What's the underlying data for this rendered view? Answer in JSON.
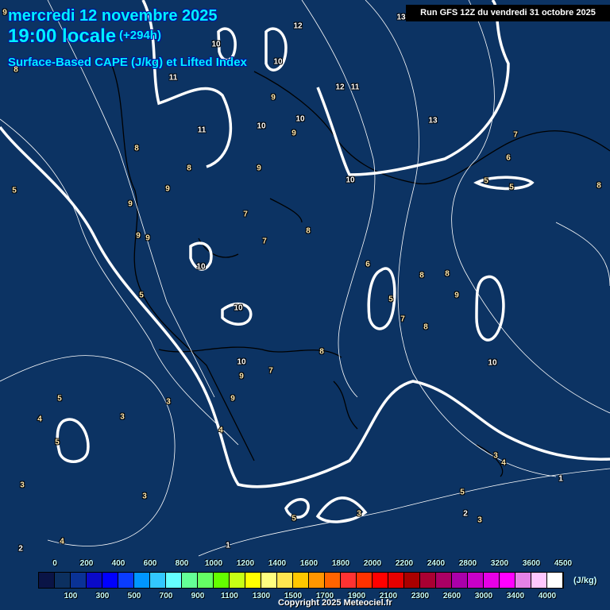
{
  "header": {
    "date": "mercredi 12 novembre 2025",
    "time": "19:00 locale",
    "lead": "(+294h)",
    "parameter": "Surface-Based CAPE (J/kg) et Lifted Index",
    "run": "Run GFS 12Z du vendredi 31 octobre 2025"
  },
  "contour_labels": [
    "9",
    "8",
    "11",
    "10",
    "10",
    "12",
    "13",
    "11",
    "12",
    "9",
    "10",
    "10",
    "9",
    "13",
    "11",
    "8",
    "8",
    "9",
    "6",
    "7",
    "5",
    "5",
    "5",
    "8",
    "9",
    "10",
    "9",
    "9",
    "7",
    "8",
    "7",
    "10",
    "6",
    "8",
    "8",
    "5",
    "9",
    "9",
    "7",
    "8",
    "5",
    "10",
    "10",
    "8",
    "10",
    "9",
    "7",
    "9",
    "3",
    "4",
    "5",
    "3",
    "5",
    "4",
    "3",
    "4",
    "3",
    "3",
    "5",
    "5",
    "3",
    "2",
    "3",
    "4",
    "1",
    "2",
    "1"
  ],
  "colorbar": {
    "unit": "(J/kg)",
    "top_labels": [
      "0",
      "200",
      "400",
      "600",
      "800",
      "1000",
      "1200",
      "1400",
      "1600",
      "1800",
      "2000",
      "2200",
      "2400",
      "2800",
      "3200",
      "3600",
      "4500"
    ],
    "bottom_labels": [
      "100",
      "300",
      "500",
      "700",
      "900",
      "1100",
      "1300",
      "1500",
      "1700",
      "1900",
      "2100",
      "2300",
      "2600",
      "3000",
      "3400",
      "4000"
    ],
    "colors": [
      "#0a1446",
      "#0c3060",
      "#0a3296",
      "#0a0ac8",
      "#0000ff",
      "#0a3cff",
      "#0096ff",
      "#32c8ff",
      "#64ffff",
      "#64ff96",
      "#64ff64",
      "#64ff00",
      "#c8ff14",
      "#ffff00",
      "#ffff80",
      "#ffe650",
      "#ffc800",
      "#ff9600",
      "#ff6400",
      "#ff3232",
      "#ff3200",
      "#ff0000",
      "#e60000",
      "#aa0000",
      "#aa0032",
      "#aa0064",
      "#aa00aa",
      "#c800c8",
      "#e600e6",
      "#ff00ff",
      "#e682e6",
      "#ffc8ff",
      "#ffffff"
    ]
  },
  "copyright": "Copyright 2025 Meteociel.fr"
}
